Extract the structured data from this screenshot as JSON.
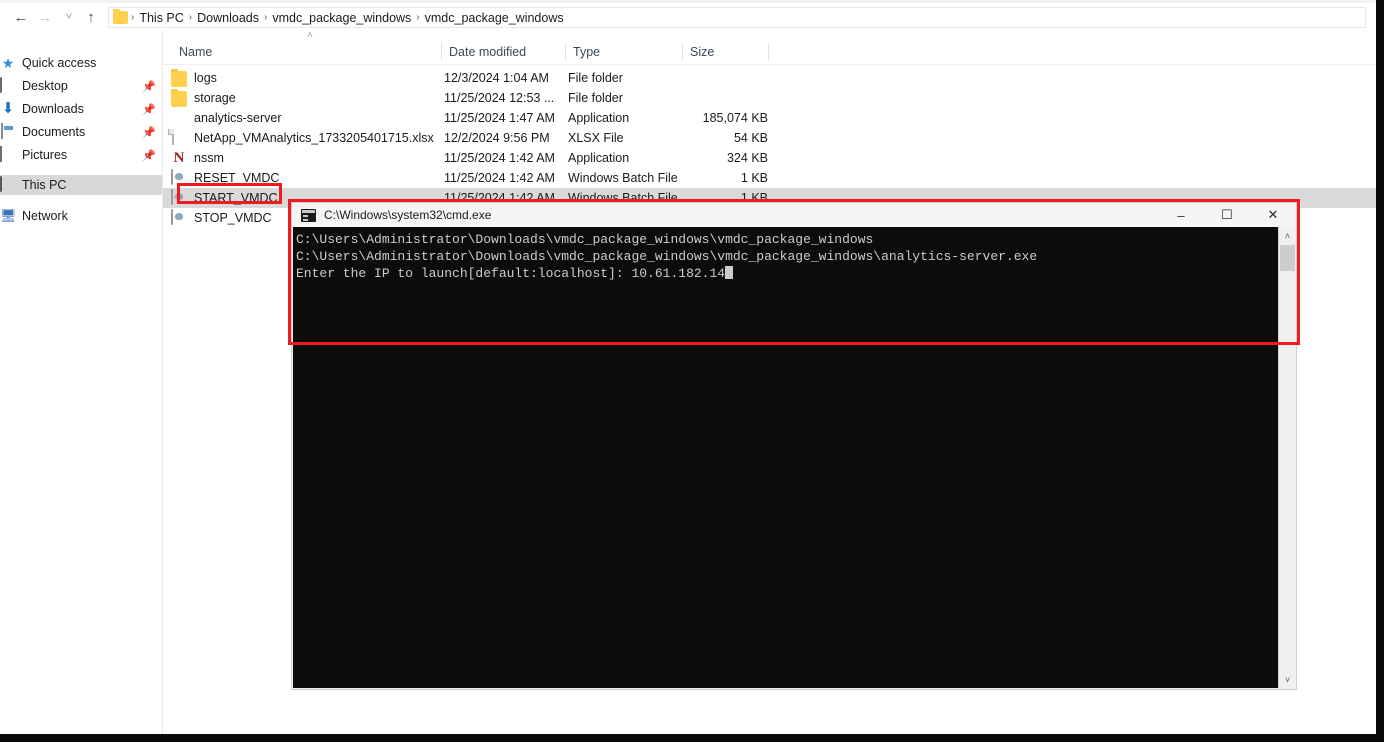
{
  "window": {
    "breadcrumb": {
      "folder_icon": "folder-icon",
      "items": [
        "This PC",
        "Downloads",
        "vmdc_package_windows",
        "vmdc_package_windows"
      ],
      "separator": "›"
    },
    "nav": {
      "back": "←",
      "forward": "→",
      "recent": "˅",
      "up": "↑"
    }
  },
  "sidebar": {
    "items": [
      {
        "label": "Quick access",
        "icon": "star-icon",
        "pinned": false,
        "selected": false
      },
      {
        "label": "Desktop",
        "icon": "desktop-icon",
        "pinned": true,
        "selected": false
      },
      {
        "label": "Downloads",
        "icon": "downloads-icon",
        "pinned": true,
        "selected": false
      },
      {
        "label": "Documents",
        "icon": "documents-icon",
        "pinned": true,
        "selected": false
      },
      {
        "label": "Pictures",
        "icon": "pictures-icon",
        "pinned": true,
        "selected": false
      },
      {
        "label": "This PC",
        "icon": "this-pc-icon",
        "pinned": false,
        "selected": true
      },
      {
        "label": "Network",
        "icon": "network-icon",
        "pinned": false,
        "selected": false
      }
    ],
    "pin_glyph": "📌"
  },
  "filelist": {
    "sort_indicator": "˄",
    "columns": [
      {
        "key": "name",
        "label": "Name"
      },
      {
        "key": "date",
        "label": "Date modified"
      },
      {
        "key": "type",
        "label": "Type"
      },
      {
        "key": "size",
        "label": "Size"
      }
    ],
    "rows": [
      {
        "name": "logs",
        "date": "12/3/2024 1:04 AM",
        "type": "File folder",
        "size": "",
        "icon": "folder-icon",
        "selected": false
      },
      {
        "name": "storage",
        "date": "11/25/2024 12:53 ...",
        "type": "File folder",
        "size": "",
        "icon": "folder-icon",
        "selected": false
      },
      {
        "name": "analytics-server",
        "date": "11/25/2024 1:47 AM",
        "type": "Application",
        "size": "185,074 KB",
        "icon": "hexagon-app-icon",
        "selected": false
      },
      {
        "name": "NetApp_VMAnalytics_1733205401715.xlsx",
        "date": "12/2/2024 9:56 PM",
        "type": "XLSX File",
        "size": "54 KB",
        "icon": "page-icon",
        "selected": false
      },
      {
        "name": "nssm",
        "date": "11/25/2024 1:42 AM",
        "type": "Application",
        "size": "324 KB",
        "icon": "nssm-n-icon",
        "selected": false
      },
      {
        "name": "RESET_VMDC",
        "date": "11/25/2024 1:42 AM",
        "type": "Windows Batch File",
        "size": "1 KB",
        "icon": "batch-file-icon",
        "selected": false
      },
      {
        "name": "START_VMDC",
        "date": "11/25/2024 1:42 AM",
        "type": "Windows Batch File",
        "size": "1 KB",
        "icon": "batch-file-icon",
        "selected": true
      },
      {
        "name": "STOP_VMDC",
        "date": "",
        "type": "",
        "size": "",
        "icon": "batch-file-icon",
        "selected": false
      }
    ]
  },
  "cmd": {
    "title": "C:\\Windows\\system32\\cmd.exe",
    "icon": "console-icon",
    "controls": {
      "minimize": "–",
      "maximize": "☐",
      "close": "✕"
    },
    "lines": [
      "C:\\Users\\Administrator\\Downloads\\vmdc_package_windows\\vmdc_package_windows",
      "C:\\Users\\Administrator\\Downloads\\vmdc_package_windows\\vmdc_package_windows\\analytics-server.exe",
      "Enter the IP to launch[default:localhost]: 10.61.182.14"
    ],
    "scrollbar": {
      "up": "˄",
      "down": "˅"
    }
  },
  "annotations": {
    "highlight_color": "#ee1c1c",
    "boxes": [
      {
        "name": "start-vmdc-highlight",
        "target": "START_VMDC"
      },
      {
        "name": "cmd-output-highlight",
        "target": "cmd-window-top"
      }
    ]
  }
}
